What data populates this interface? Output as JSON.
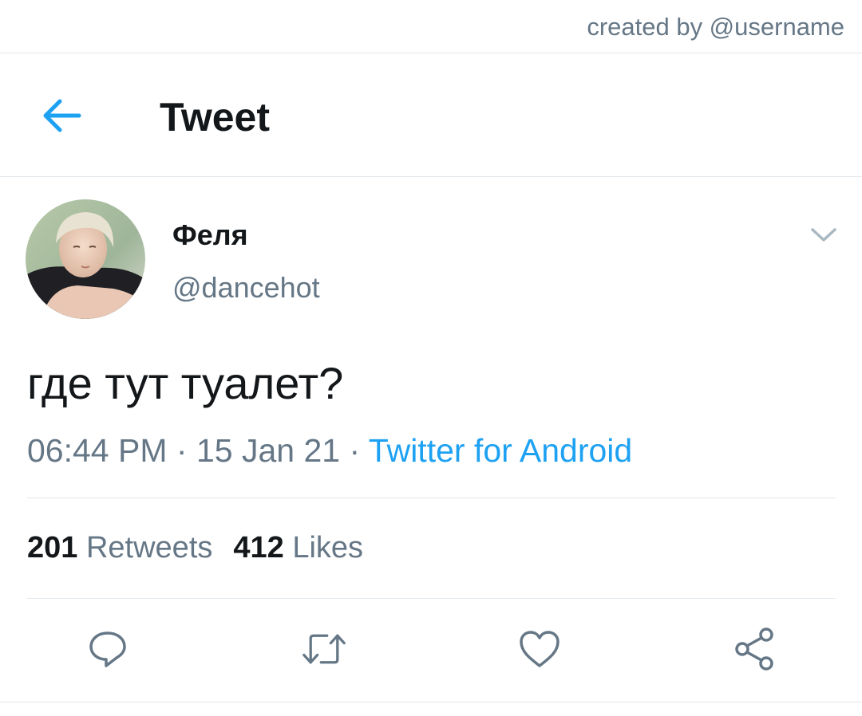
{
  "credit": "created by @username",
  "header": {
    "title": "Tweet",
    "back_icon": "arrow-left-icon"
  },
  "tweet": {
    "display_name": "Феля",
    "handle": "@dancehot",
    "text": "где тут туалет?",
    "time": "06:44 PM",
    "date": "15 Jan 21",
    "separator": "·",
    "source": "Twitter for Android",
    "menu_icon": "chevron-down-icon"
  },
  "stats": {
    "retweets_count": "201",
    "retweets_label": "Retweets",
    "likes_count": "412",
    "likes_label": "Likes"
  },
  "actions": [
    {
      "icon": "reply-icon"
    },
    {
      "icon": "retweet-icon"
    },
    {
      "icon": "like-icon"
    },
    {
      "icon": "share-icon"
    }
  ],
  "colors": {
    "accent": "#1da1f2",
    "text": "#14171a",
    "secondary": "#657786",
    "border": "#e1e8ed"
  }
}
